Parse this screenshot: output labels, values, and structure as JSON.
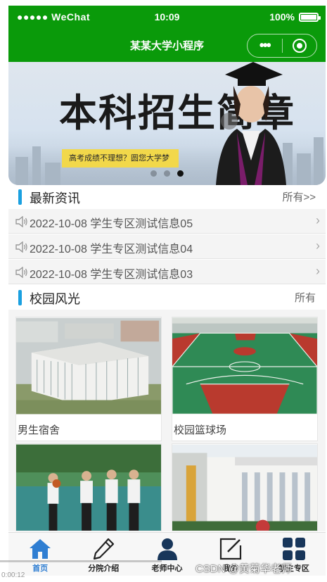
{
  "status_bar": {
    "carrier": "●●●●● WeChat",
    "time": "10:09",
    "battery": "100%"
  },
  "nav": {
    "title": "某某大学小程序",
    "more_glyph": "•••"
  },
  "banner": {
    "title": "本科招生简章",
    "subtitle": "高考成绩不理想？圆您大学梦",
    "active_dot": 2
  },
  "news_section": {
    "title": "最新资讯",
    "more": "所有>>"
  },
  "news": [
    {
      "text": "2022-10-08 学生专区测试信息05"
    },
    {
      "text": "2022-10-08 学生专区测试信息04"
    },
    {
      "text": "2022-10-08 学生专区测试信息03"
    }
  ],
  "campus_section": {
    "title": "校园风光",
    "more": "所有"
  },
  "campus": [
    {
      "caption": "男生宿舍"
    },
    {
      "caption": "校园篮球场"
    },
    {
      "caption": ""
    },
    {
      "caption": ""
    }
  ],
  "tabs": [
    {
      "label": "首页",
      "icon": "home-icon",
      "active": true
    },
    {
      "label": "分院介绍",
      "icon": "pencil-icon"
    },
    {
      "label": "老师中心",
      "icon": "user-icon"
    },
    {
      "label": "我的",
      "icon": "edit-icon"
    },
    {
      "label": "学生专区",
      "icon": "grid-icon"
    }
  ],
  "watermark": "CSDN @黄菊华老师",
  "timecode": "0:00:12",
  "colors": {
    "nav_green": "#0a9a0a",
    "accent_blue": "#1aa0e0"
  }
}
